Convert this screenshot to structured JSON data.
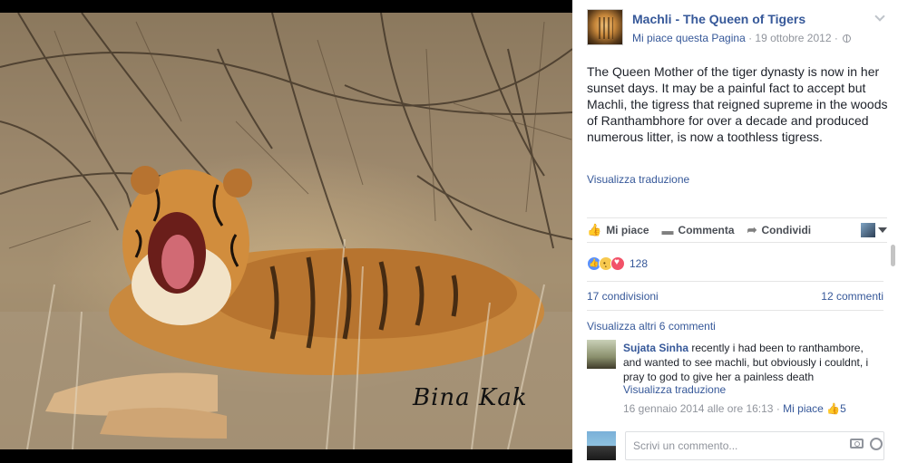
{
  "photo": {
    "watermark": "Bina Kak"
  },
  "post": {
    "page_name": "Machli - The Queen of Tigers",
    "like_page_link": "Mi piace questa Pagina",
    "separator": " · ",
    "date": "19 ottobre 2012",
    "text": "The Queen Mother of the tiger dynasty is now in her sunset days. It may be a painful fact to accept but Machli, the tigress that reigned supreme in the woods of Ranthambhore for over a decade and produced numerous litter, is now a toothless tigress.",
    "see_translation": "Visualizza traduzione"
  },
  "actions": {
    "like": "Mi piace",
    "comment": "Commenta",
    "share": "Condividi"
  },
  "reactions": {
    "count": "128"
  },
  "stats": {
    "shares": "17 condivisioni",
    "comments": "12 commenti"
  },
  "view_more_comments": "Visualizza altri 6 commenti",
  "comment": {
    "author": "Sujata Sinha",
    "text": " recently i had been to ranthambore, and wanted to see machli, but obviously i couldnt, i pray to god to give her a painless death",
    "see_translation": "Visualizza traduzione",
    "timestamp": "16 gennaio 2014 alle ore 16:13",
    "like_link": "Mi piace",
    "like_count": "5"
  },
  "compose": {
    "placeholder": "Scrivi un commento..."
  },
  "icons": {
    "globe": "globe-icon",
    "chevron": "chevron-down-icon",
    "like": "thumbs-up-icon",
    "comment": "speech-bubble-icon",
    "share": "share-arrow-icon",
    "camera": "camera-icon",
    "emoji": "emoji-icon"
  },
  "colors": {
    "link": "#365899",
    "meta": "#90949c",
    "text": "#1d2129",
    "like_reaction": "#5890ff",
    "love_reaction": "#f25268",
    "sad_reaction": "#f7c94f"
  }
}
